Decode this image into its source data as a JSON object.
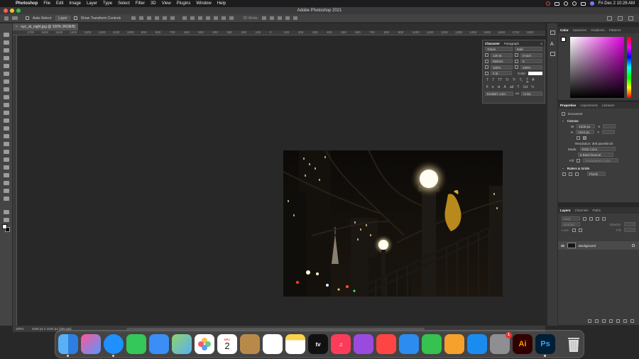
{
  "menubar": {
    "app": "Photoshop",
    "items": [
      "File",
      "Edit",
      "Image",
      "Layer",
      "Type",
      "Select",
      "Filter",
      "3D",
      "View",
      "Plugins",
      "Window",
      "Help"
    ],
    "datetime": "Fri Dec 2  10:26 AM"
  },
  "window": {
    "title": "Adobe Photoshop 2021"
  },
  "options_bar": {
    "auto_select_label": "Auto-Select:",
    "auto_select_value": "Layer",
    "transform_label": "Show Transform Controls",
    "mode_label": "3D Mode:"
  },
  "document": {
    "tab_title": "nyc_at_night.jpg @ 100% (RGB/8)",
    "ruler_ticks": [
      "1700",
      "1600",
      "1500",
      "1400",
      "1300",
      "1200",
      "1100",
      "1000",
      "900",
      "800",
      "700",
      "600",
      "500",
      "400",
      "300",
      "200",
      "100",
      "0",
      "100",
      "200",
      "300",
      "400",
      "500",
      "600",
      "700",
      "800",
      "900",
      "1000",
      "1100",
      "1200",
      "1300",
      "1400",
      "1500",
      "1600",
      "1700",
      "1800"
    ],
    "zoom": "100%",
    "doc_info": "1536 px x 1024 px (300 ppi)"
  },
  "character_panel": {
    "tabs": [
      "Character",
      "Paragraph"
    ],
    "font_family": "Times",
    "font_style": "Italic",
    "font_size": "120 pt",
    "leading": "(Auto)",
    "kerning": "Metrics",
    "tracking": "0",
    "vertical_scale": "100%",
    "horizontal_scale": "100%",
    "baseline_shift": "0 pt",
    "color_label": "Color:",
    "text_style_glyphs": [
      "T",
      "T",
      "TT",
      "Tr",
      "T¹",
      "T₁",
      "T",
      "T"
    ],
    "opentype_glyphs": [
      "fi",
      "σ",
      "st",
      "A",
      "ad",
      "T",
      "1st",
      "½"
    ],
    "language": "English: USA",
    "antialias_icon": "aa",
    "antialias": "Crisp"
  },
  "color_panel": {
    "tabs": [
      "Color",
      "Swatches",
      "Gradients",
      "Patterns"
    ]
  },
  "properties_panel": {
    "tabs": [
      "Properties",
      "Adjustments",
      "Libraries"
    ],
    "doc_label": "Document",
    "canvas_heading": "Canvas",
    "w_label": "W",
    "width": "1536 px",
    "x_label": "X",
    "h_label": "H",
    "height": "1024 px",
    "y_label": "Y",
    "resolution": "Resolution: 300 pixels/inch",
    "mode_label": "Mode:",
    "mode": "RGB Color",
    "bit_depth": "8 Bits/Channel",
    "fill_label": "Fill",
    "fill": "Transparent Color",
    "rulers_heading": "Rulers & Grids",
    "ruler_unit": "Pixels"
  },
  "layers_panel": {
    "tabs": [
      "Layers",
      "Channels",
      "Paths"
    ],
    "kind_label": "Kind",
    "blend_mode": "Normal",
    "opacity_label": "Opacity:",
    "lock_label": "Lock:",
    "fill_label": "Fill:",
    "layer_name": "Background"
  },
  "dock": {
    "calendar_month": "DEC",
    "calendar_day": "2",
    "tv_label": "tv",
    "settings_badge": "1",
    "ai_label": "Ai",
    "ps_label": "Ps"
  }
}
